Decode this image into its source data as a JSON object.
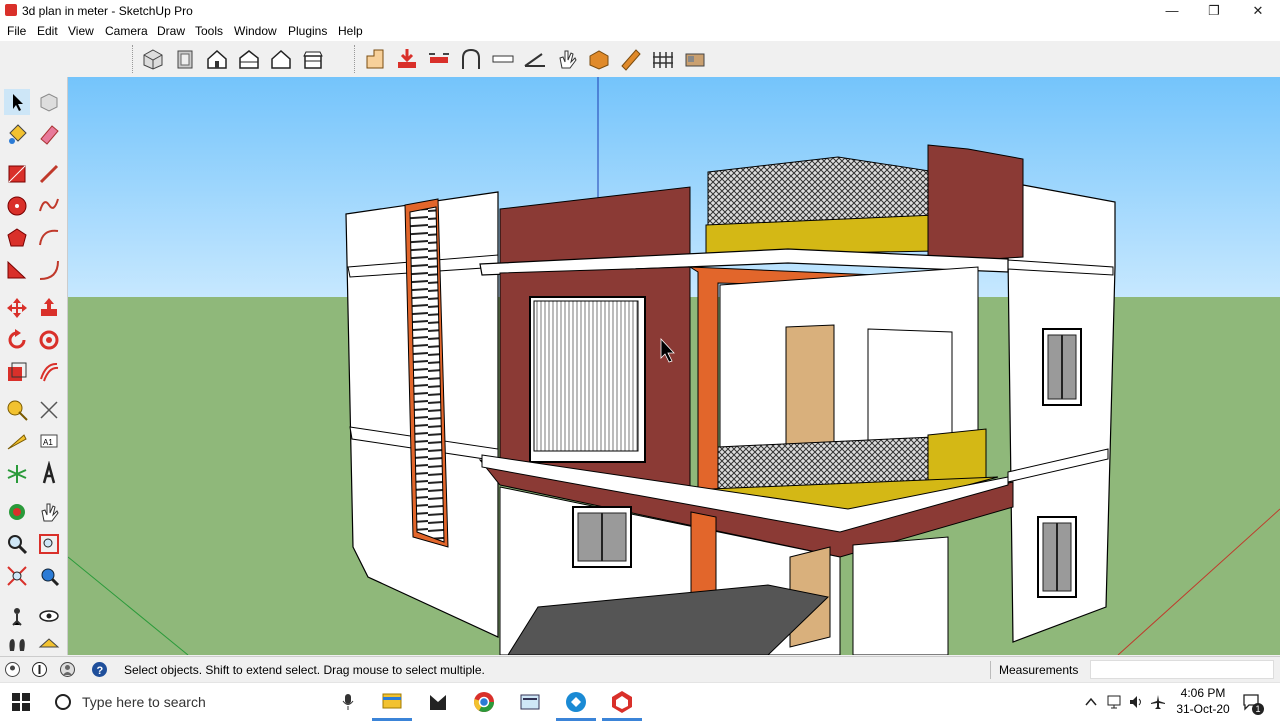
{
  "window": {
    "title": "3d plan in meter - SketchUp Pro",
    "minimize": "—",
    "restore": "❐",
    "close": "✕"
  },
  "menu": [
    "File",
    "Edit",
    "View",
    "Camera",
    "Draw",
    "Tools",
    "Window",
    "Plugins",
    "Help"
  ],
  "status": {
    "hint": "Select objects. Shift to extend select. Drag mouse to select multiple.",
    "measurements_label": "Measurements",
    "measurements_value": ""
  },
  "taskbar": {
    "search_placeholder": "Type here to search",
    "time": "4:06 PM",
    "date": "31-Oct-20",
    "notification_count": "1"
  },
  "colors": {
    "sky": "#8fd2ff",
    "ground": "#8fb87a",
    "maroon": "#8b3a35",
    "orange": "#e2662b",
    "yellow": "#d4b815",
    "door": "#d9b07c"
  },
  "toolbar_icons": [
    "select-icon",
    "component-icon",
    "paint-bucket-icon",
    "eraser-icon",
    "rectangle-icon",
    "line-icon",
    "circle-icon",
    "arc-icon",
    "polygon-icon",
    "freehand-icon",
    "move-icon",
    "push-pull-icon",
    "rotate-icon",
    "follow-me-icon",
    "scale-icon",
    "offset-icon",
    "tape-measure-icon",
    "dimension-icon",
    "protractor-icon",
    "text-icon",
    "axes-icon",
    "3d-text-icon",
    "orbit-icon",
    "pan-icon",
    "zoom-icon",
    "zoom-window-icon",
    "zoom-extents-icon",
    "previous-view-icon",
    "walk-icon",
    "look-around-icon",
    "position-camera-icon",
    "section-plane-icon"
  ]
}
